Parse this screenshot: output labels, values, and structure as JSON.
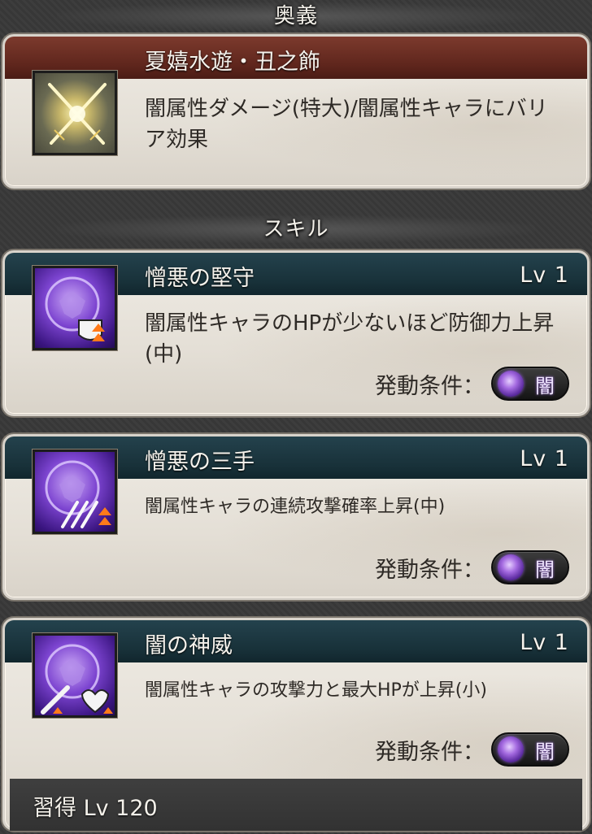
{
  "ougi": {
    "header": "奥義",
    "title": "夏嬉水遊・丑之飾",
    "description": "闇属性ダメージ(特大)/闇属性キャラにバリア効果",
    "icon": "crossed-swords-icon"
  },
  "skills_header": "スキル",
  "skills": [
    {
      "name": "憎悪の堅守",
      "level": "Lv 1",
      "description": "闇属性キャラのHPが少ないほど防御力上昇(中)",
      "condition_label": "発動条件：",
      "element": "闇",
      "icon": "dark-shield-up-icon"
    },
    {
      "name": "憎悪の三手",
      "level": "Lv 1",
      "description": "闇属性キャラの連続攻撃確率上昇(中)",
      "condition_label": "発動条件：",
      "element": "闇",
      "icon": "dark-multiattack-up-icon"
    },
    {
      "name": "闇の神威",
      "level": "Lv 1",
      "description": "闇属性キャラの攻撃力と最大HPが上昇(小)",
      "condition_label": "発動条件：",
      "element": "闇",
      "icon": "dark-attack-hp-up-icon"
    }
  ],
  "acquire": "習得 Lv 120",
  "colors": {
    "dark_element": "#7b3fc4",
    "ougi_bar": "#6a2c22",
    "skill_bar": "#1c3841"
  }
}
